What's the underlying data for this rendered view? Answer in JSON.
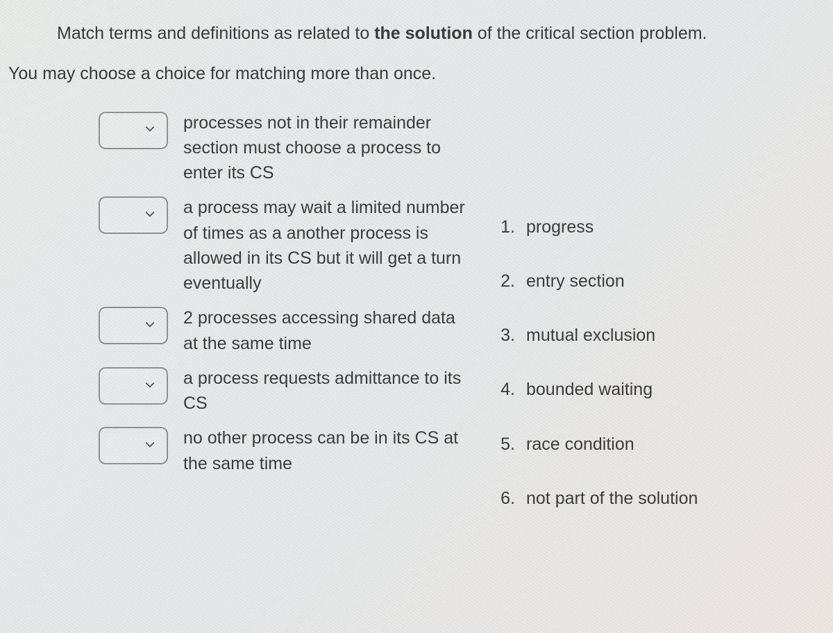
{
  "prompt_part1": "Match terms and definitions as related to ",
  "prompt_strong": "the solution",
  "prompt_part2": " of the critical section problem.",
  "hint": "You may choose a choice for matching more than once.",
  "items": [
    {
      "definition": "processes not in their remainder section must choose a process to enter its CS"
    },
    {
      "definition": "a process may wait a limited number of times as a another process is allowed in its CS but it will get a turn eventually"
    },
    {
      "definition": "2 processes accessing shared data at the same time"
    },
    {
      "definition": "a process requests admittance to its CS"
    },
    {
      "definition": "no other process can be in its CS at the same time"
    }
  ],
  "options": [
    {
      "num": "1.",
      "label": "progress"
    },
    {
      "num": "2.",
      "label": "entry section"
    },
    {
      "num": "3.",
      "label": "mutual exclusion"
    },
    {
      "num": "4.",
      "label": "bounded waiting"
    },
    {
      "num": "5.",
      "label": "race condition"
    },
    {
      "num": "6.",
      "label": "not part of the solution"
    }
  ]
}
